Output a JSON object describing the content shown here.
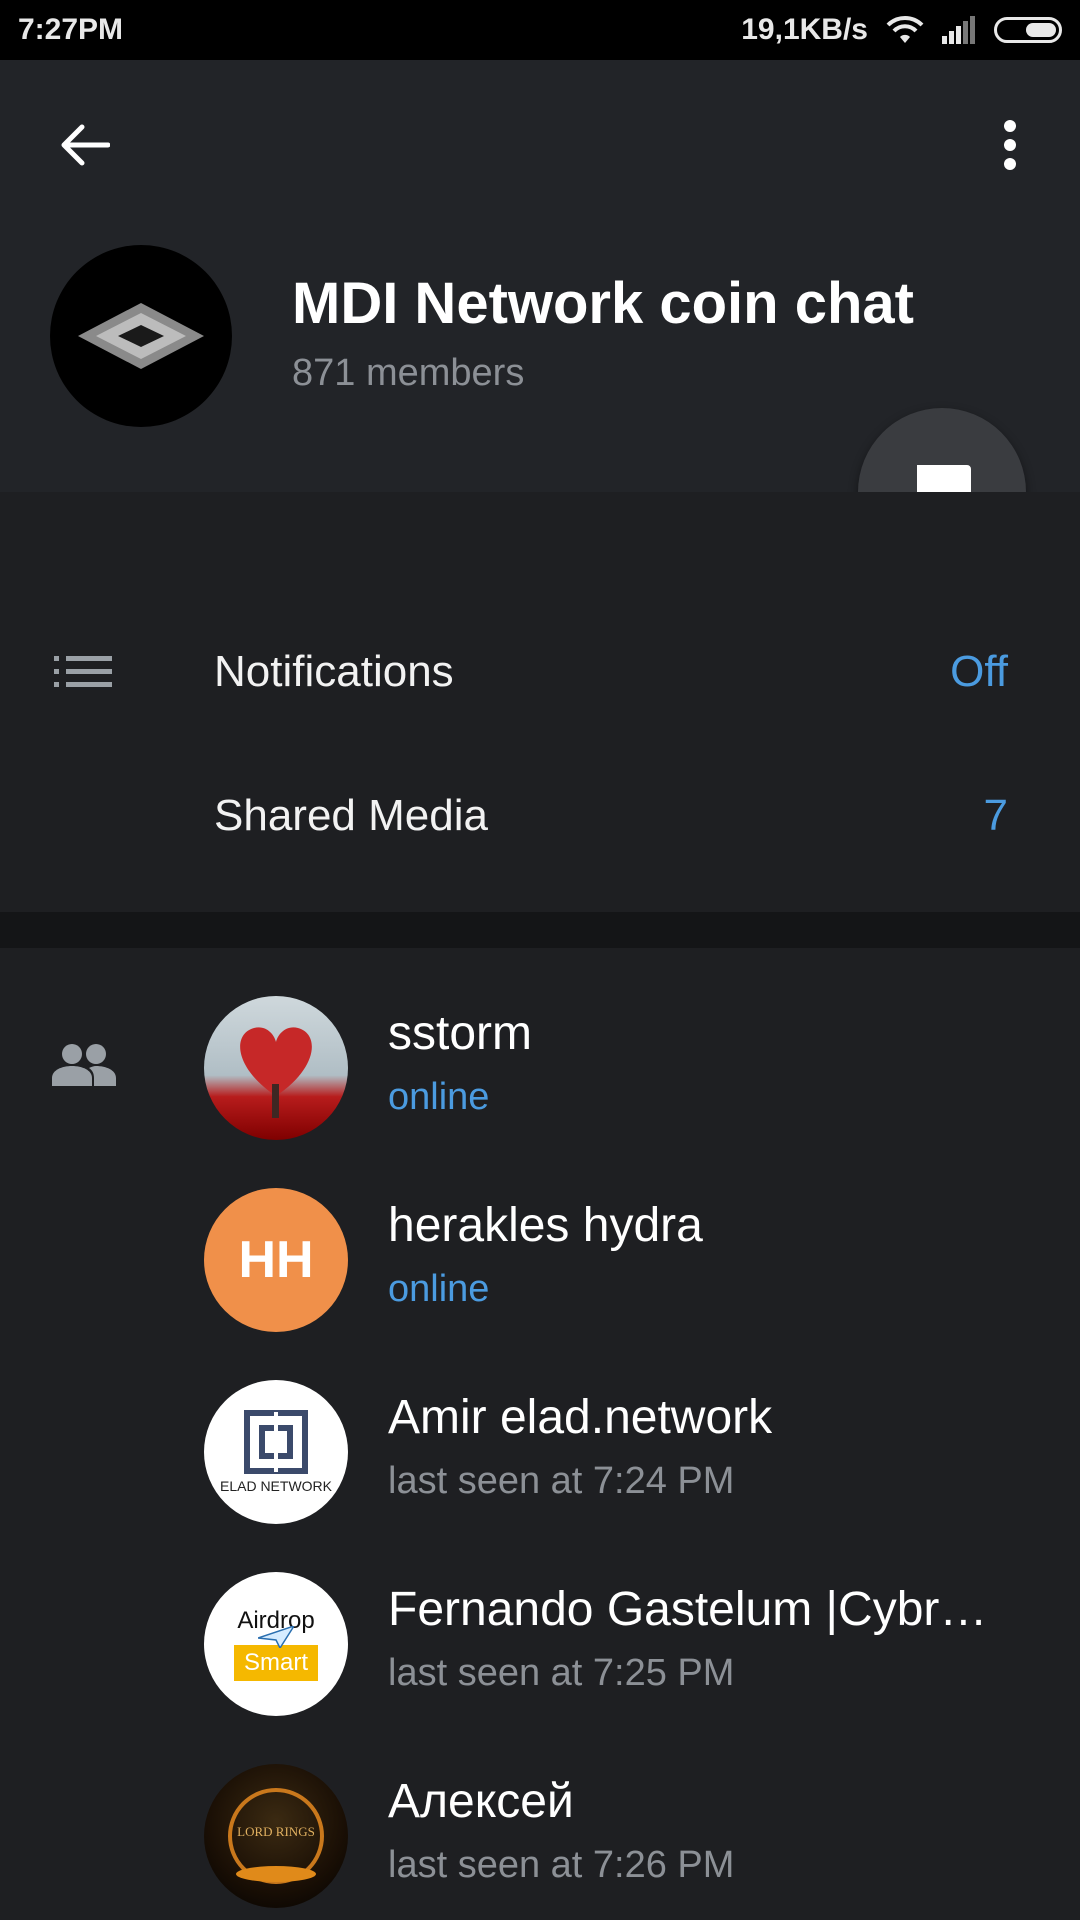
{
  "status_bar": {
    "time": "7:27PM",
    "speed": "19,1KB/s"
  },
  "header": {
    "group_name": "MDI Network coin chat",
    "members_count": "871 members"
  },
  "settings": {
    "notifications_label": "Notifications",
    "notifications_value": "Off",
    "shared_media_label": "Shared Media",
    "shared_media_value": "7"
  },
  "members": [
    {
      "name": "sstorm",
      "status": "online",
      "avatar": "heart-tree"
    },
    {
      "name": "herakles hydra",
      "status": "online",
      "avatar_initials": "HH",
      "avatar_color": "#f0904a"
    },
    {
      "name": "Amir elad.network",
      "status": "last seen at 7:24 PM",
      "avatar_text": "ELAD NETWORK"
    },
    {
      "name": "Fernando Gastelum |Cybr…",
      "status": "last seen at 7:25 PM",
      "avatar_text_top": "Airdrop",
      "avatar_text_bottom": "Smart"
    },
    {
      "name": "Алексей",
      "status": "last seen at 7:26 PM",
      "avatar_text": "LORD RINGS"
    }
  ],
  "colors": {
    "accent": "#4b9be0",
    "header_bg": "#222428",
    "body_bg": "#1e1f22"
  }
}
